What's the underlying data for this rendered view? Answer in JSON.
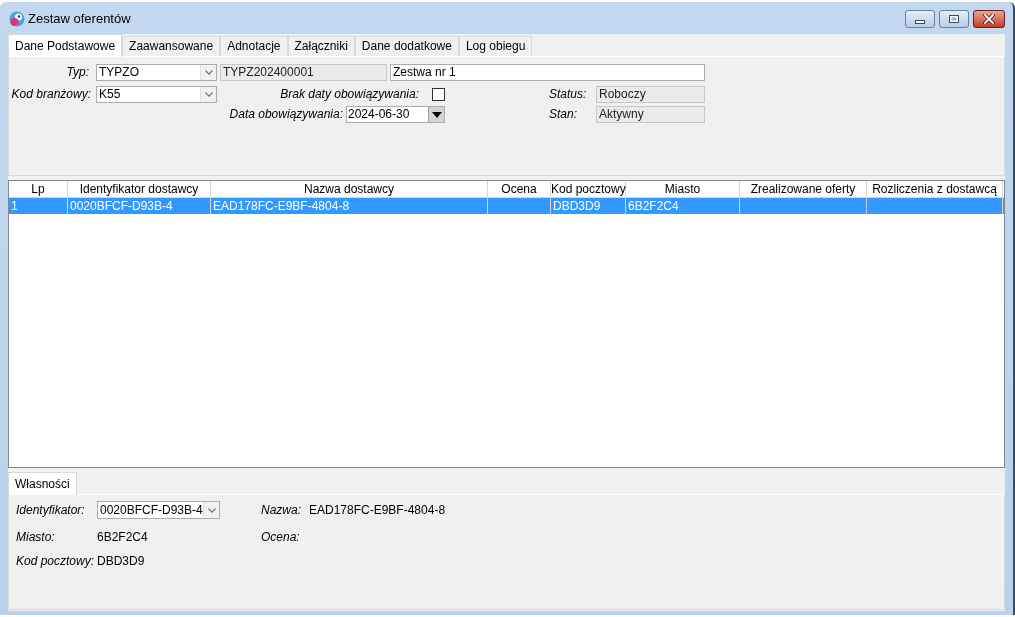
{
  "window": {
    "title": "Zestaw oferentów"
  },
  "tabs": [
    {
      "label": "Dane Podstawowe",
      "selected": true
    },
    {
      "label": "Zaawansowane",
      "selected": false
    },
    {
      "label": "Adnotacje",
      "selected": false
    },
    {
      "label": "Załączniki",
      "selected": false
    },
    {
      "label": "Dane dodatkowe",
      "selected": false
    },
    {
      "label": "Log obiegu",
      "selected": false
    }
  ],
  "form": {
    "type": {
      "label": "Typ:",
      "value": "TYPZO"
    },
    "number": {
      "value": "TYPZ202400001",
      "read_only": true
    },
    "name": {
      "value": "Zestwa nr 1",
      "read_only": false
    },
    "industry_code": {
      "label": "Kod branżowy:",
      "value": "K55"
    },
    "no_date": {
      "label": "Brak daty obowiązywania:",
      "checked": false
    },
    "valid_date": {
      "label": "Data obowiązywania:",
      "value": "2024-06-30"
    },
    "status": {
      "label": "Status:",
      "value": "Roboczy",
      "read_only": true
    },
    "state": {
      "label": "Stan:",
      "value": "Aktywny",
      "read_only": true
    }
  },
  "table": {
    "columns": [
      "Lp",
      "Identyfikator dostawcy",
      "Nazwa dostawcy",
      "Ocena",
      "Kod pocztowy",
      "Miasto",
      "Zrealizowane oferty",
      "Rozliczenia z dostawcą"
    ],
    "rows": [
      {
        "selected": true,
        "cells": [
          "1",
          "0020BFCF-D93B-4",
          "EAD178FC-E9BF-4804-8",
          null,
          "DBD3D9",
          "6B2F2C4",
          null,
          null
        ]
      }
    ]
  },
  "bottom_tabs": [
    {
      "label": "Własności",
      "selected": true
    }
  ],
  "properties": {
    "identifier": {
      "label": "Identyfikator:",
      "value": "0020BFCF-D93B-4"
    },
    "name": {
      "label": "Nazwa:",
      "value": "EAD178FC-E9BF-4804-8"
    },
    "city": {
      "label": "Miasto:",
      "value": "6B2F2C4"
    },
    "rating": {
      "label": "Ocena:"
    },
    "postal_code": {
      "label": "Kod pocztowy:",
      "value": "DBD3D9"
    }
  }
}
